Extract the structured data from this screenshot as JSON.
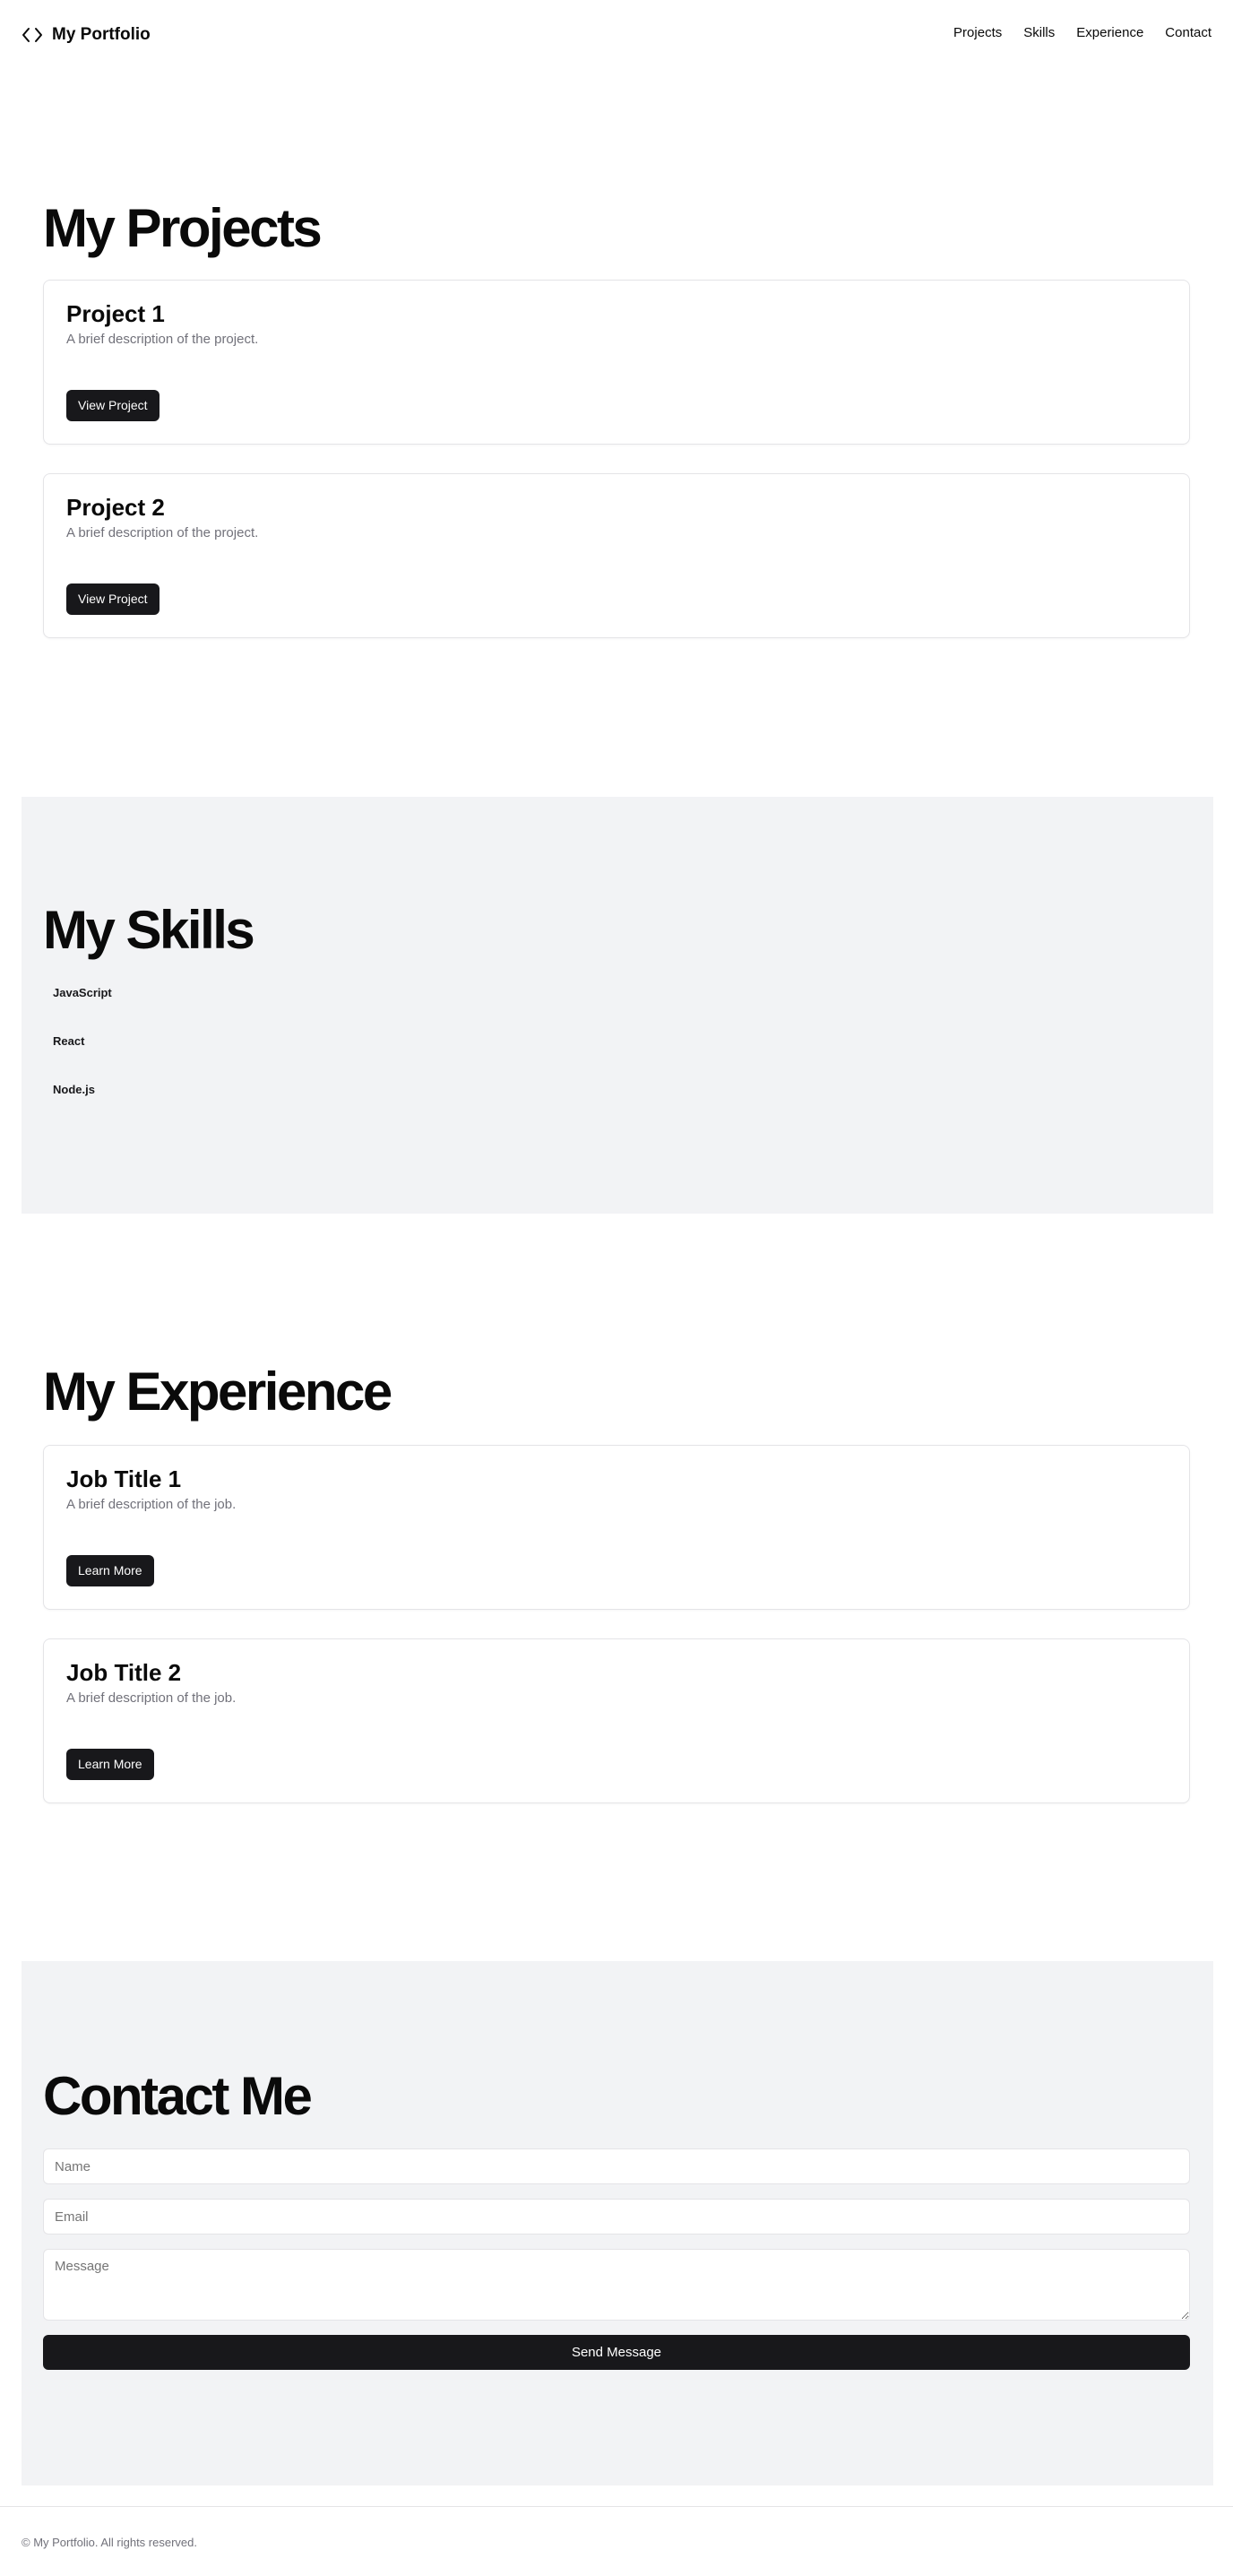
{
  "header": {
    "brand": "My Portfolio",
    "brand_icon": "code-icon",
    "nav": [
      "Projects",
      "Skills",
      "Experience",
      "Contact"
    ]
  },
  "projects": {
    "title": "My Projects",
    "items": [
      {
        "title": "Project 1",
        "description": "A brief description of the project.",
        "button": "View Project"
      },
      {
        "title": "Project 2",
        "description": "A brief description of the project.",
        "button": "View Project"
      }
    ]
  },
  "skills": {
    "title": "My Skills",
    "items": [
      "JavaScript",
      "React",
      "Node.js"
    ]
  },
  "experience": {
    "title": "My Experience",
    "items": [
      {
        "title": "Job Title 1",
        "description": "A brief description of the job.",
        "button": "Learn More"
      },
      {
        "title": "Job Title 2",
        "description": "A brief description of the job.",
        "button": "Learn More"
      }
    ]
  },
  "contact": {
    "title": "Contact Me",
    "name_placeholder": "Name",
    "email_placeholder": "Email",
    "message_placeholder": "Message",
    "submit": "Send Message"
  },
  "footer": {
    "text": "© My Portfolio. All rights reserved."
  }
}
